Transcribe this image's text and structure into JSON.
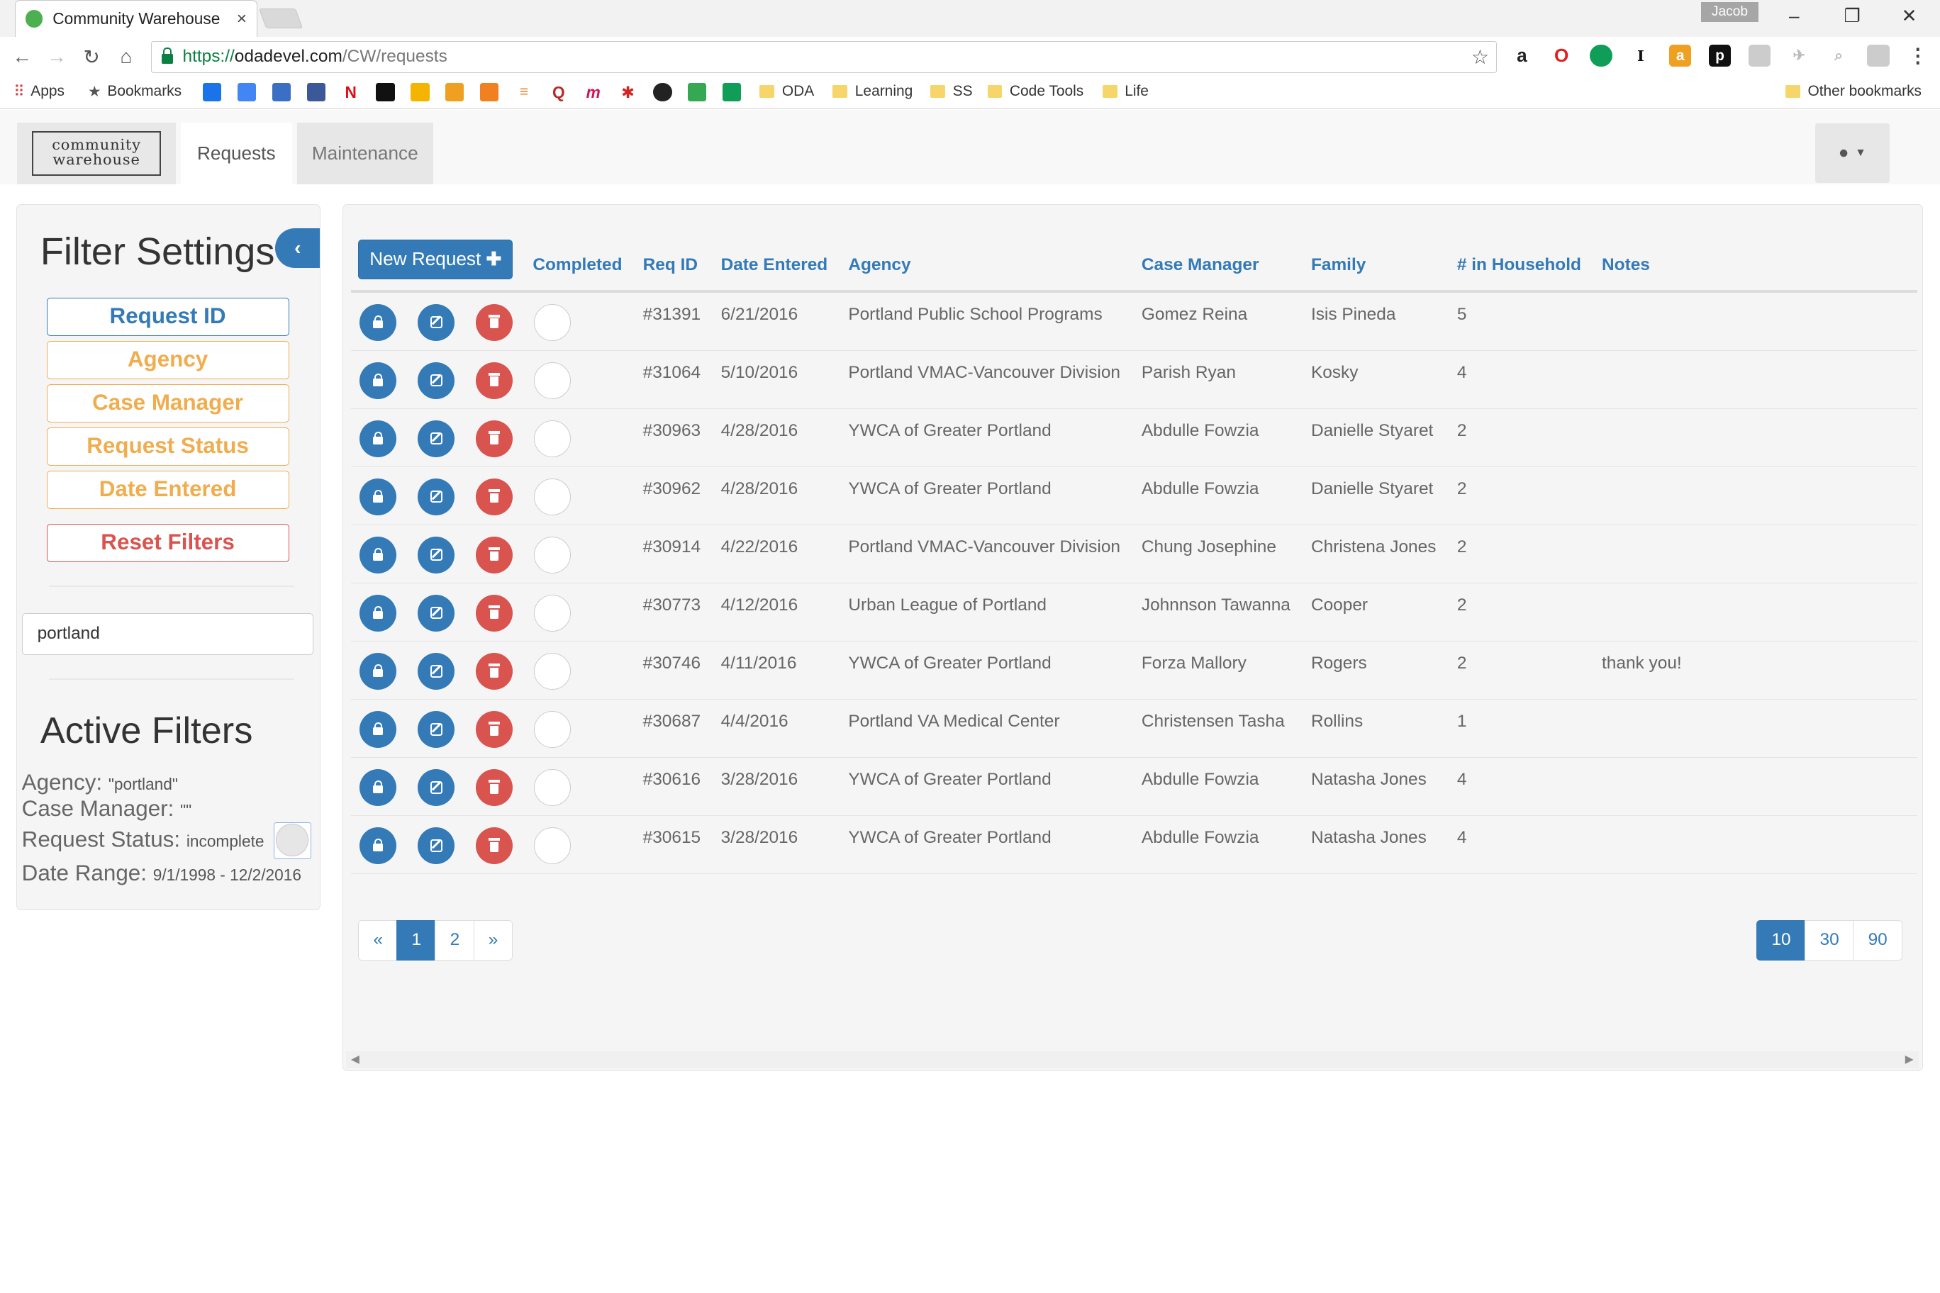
{
  "browser": {
    "tab_title": "Community Warehouse",
    "tab_close": "×",
    "profile": "Jacob",
    "url": {
      "scheme": "https://",
      "host": "odadevel.com",
      "path": "/CW/requests"
    },
    "bookmarks": [
      {
        "label": "Apps",
        "icon": "apps-grid-icon"
      },
      {
        "label": "Bookmarks",
        "icon": "star-icon"
      },
      {
        "label": "ODA",
        "icon": "folder-icon"
      },
      {
        "label": "Learning",
        "icon": "folder-icon"
      },
      {
        "label": "SS",
        "icon": "folder-icon"
      },
      {
        "label": "Code Tools",
        "icon": "folder-icon"
      },
      {
        "label": "Life",
        "icon": "folder-icon"
      }
    ],
    "other_bookmarks": "Other bookmarks"
  },
  "navbar": {
    "logo_line1": "community",
    "logo_line2": "warehouse",
    "tabs": [
      {
        "label": "Requests",
        "active": true
      },
      {
        "label": "Maintenance",
        "active": false
      }
    ],
    "user_menu_icon": "user-icon"
  },
  "filter_panel": {
    "title": "Filter Settings",
    "collapse_icon": "chevron-left-icon",
    "buttons": {
      "request_id": "Request ID",
      "agency": "Agency",
      "case_manager": "Case Manager",
      "request_status": "Request Status",
      "date_entered": "Date Entered",
      "reset": "Reset Filters"
    },
    "search_value": "portland",
    "active_filters_title": "Active Filters",
    "active_filters": {
      "agency_label": "Agency:",
      "agency_value": "\"portland\"",
      "case_manager_label": "Case Manager:",
      "case_manager_value": "\"\"",
      "status_label": "Request Status:",
      "status_value": "incomplete",
      "date_label": "Date Range:",
      "date_value": "9/1/1998 - 12/2/2016"
    }
  },
  "table": {
    "new_request_label": "New Request",
    "columns": {
      "completed": "Completed",
      "req_id": "Req ID",
      "date_entered": "Date Entered",
      "agency": "Agency",
      "case_manager": "Case Manager",
      "family": "Family",
      "household": "# in Household",
      "notes": "Notes"
    },
    "row_action_icons": [
      "lock-icon",
      "edit-icon",
      "trash-icon"
    ],
    "rows": [
      {
        "req_id": "#31391",
        "date": "6/21/2016",
        "agency": "Portland Public School Programs",
        "case_manager": "Gomez Reina",
        "family": "Isis Pineda",
        "household": "5",
        "notes": ""
      },
      {
        "req_id": "#31064",
        "date": "5/10/2016",
        "agency": "Portland VMAC-Vancouver Division",
        "case_manager": "Parish Ryan",
        "family": "Kosky",
        "household": "4",
        "notes": ""
      },
      {
        "req_id": "#30963",
        "date": "4/28/2016",
        "agency": "YWCA of Greater Portland",
        "case_manager": "Abdulle Fowzia",
        "family": "Danielle Styaret",
        "household": "2",
        "notes": ""
      },
      {
        "req_id": "#30962",
        "date": "4/28/2016",
        "agency": "YWCA of Greater Portland",
        "case_manager": "Abdulle Fowzia",
        "family": "Danielle Styaret",
        "household": "2",
        "notes": ""
      },
      {
        "req_id": "#30914",
        "date": "4/22/2016",
        "agency": "Portland VMAC-Vancouver Division",
        "case_manager": "Chung Josephine",
        "family": "Christena Jones",
        "household": "2",
        "notes": ""
      },
      {
        "req_id": "#30773",
        "date": "4/12/2016",
        "agency": "Urban League of Portland",
        "case_manager": "Johnnson Tawanna",
        "family": "Cooper",
        "household": "2",
        "notes": ""
      },
      {
        "req_id": "#30746",
        "date": "4/11/2016",
        "agency": "YWCA of Greater Portland",
        "case_manager": "Forza Mallory",
        "family": "Rogers",
        "household": "2",
        "notes": "thank you!"
      },
      {
        "req_id": "#30687",
        "date": "4/4/2016",
        "agency": "Portland VA Medical Center",
        "case_manager": "Christensen Tasha",
        "family": "Rollins",
        "household": "1",
        "notes": ""
      },
      {
        "req_id": "#30616",
        "date": "3/28/2016",
        "agency": "YWCA of Greater Portland",
        "case_manager": "Abdulle Fowzia",
        "family": "Natasha Jones",
        "household": "4",
        "notes": ""
      },
      {
        "req_id": "#30615",
        "date": "3/28/2016",
        "agency": "YWCA of Greater Portland",
        "case_manager": "Abdulle Fowzia",
        "family": "Natasha Jones",
        "household": "4",
        "notes": ""
      }
    ],
    "pagination": {
      "prev": "«",
      "pages": [
        "1",
        "2"
      ],
      "current": "1",
      "next": "»"
    },
    "page_sizes": [
      "10",
      "30",
      "90"
    ],
    "page_size_selected": "10"
  },
  "colors": {
    "primary": "#337ab7",
    "warning": "#f0ad4e",
    "danger": "#d9534f"
  }
}
